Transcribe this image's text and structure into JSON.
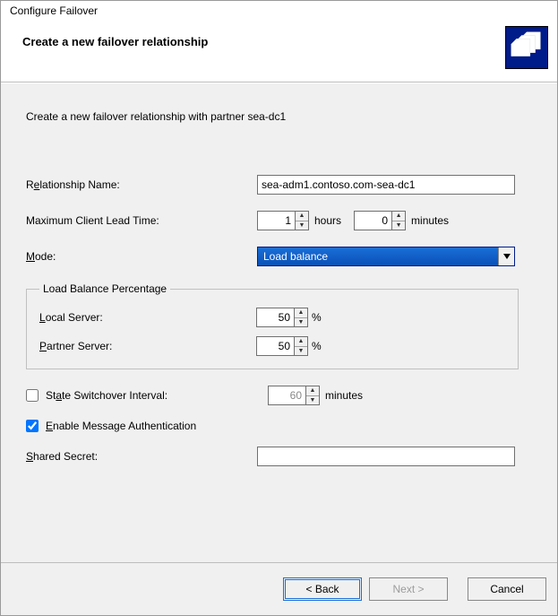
{
  "window": {
    "title": "Configure Failover"
  },
  "header": {
    "title": "Create a new failover relationship"
  },
  "body": {
    "intro": "Create a new failover relationship with partner sea-dc1",
    "relationship_name": {
      "label_pre": "R",
      "label_u": "e",
      "label_post": "lationship Name:",
      "value": "sea-adm1.contoso.com-sea-dc1"
    },
    "max_client_lead": {
      "label": "Maximum Client Lead Time:",
      "hours": "1",
      "hours_unit": "hours",
      "minutes": "0",
      "minutes_unit": "minutes"
    },
    "mode": {
      "label_u": "M",
      "label_post": "ode:",
      "selected": "Load balance"
    },
    "load_balance": {
      "legend": "Load Balance Percentage",
      "local": {
        "label_u": "L",
        "label_post": "ocal Server:",
        "value": "50"
      },
      "partner": {
        "label_u": "P",
        "label_post": "artner Server:",
        "value": "50"
      },
      "pct": "%"
    },
    "state_switchover": {
      "label_pre": "St",
      "label_u": "a",
      "label_post": "te Switchover Interval:",
      "value": "60",
      "unit": "minutes",
      "checked": false
    },
    "enable_msg_auth": {
      "label_u": "E",
      "label_post": "nable Message Authentication",
      "checked": true
    },
    "shared_secret": {
      "label_u": "S",
      "label_post": "hared Secret:",
      "value": ""
    }
  },
  "footer": {
    "back": "< Back",
    "next": "Next >",
    "cancel": "Cancel"
  }
}
